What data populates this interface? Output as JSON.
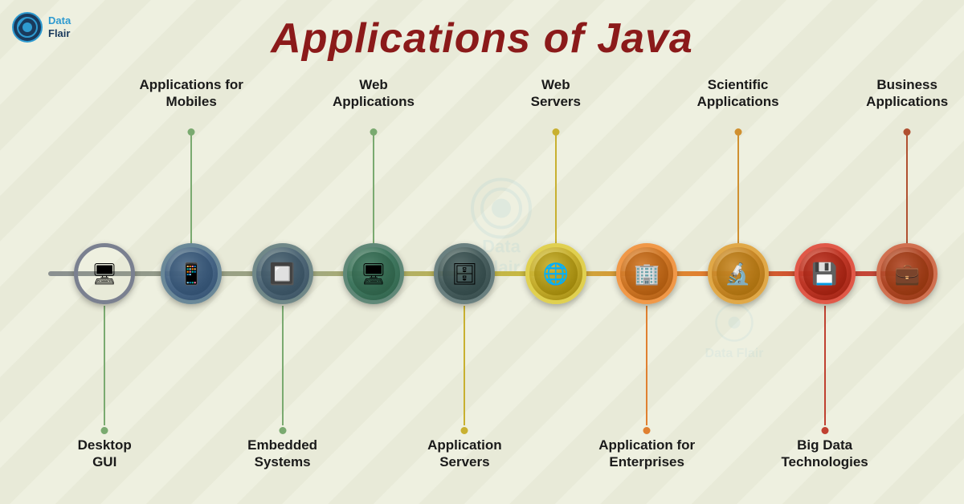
{
  "title": "Applications of Java",
  "logo": {
    "text_line1": "Data",
    "text_line2": "Flair"
  },
  "nodes": [
    {
      "id": 1,
      "label": "Desktop\nGUI",
      "position": "below",
      "left_pct": 6.5,
      "icon": "🖥",
      "line_color": "#7aaa70",
      "dot_color": "#7aaa70"
    },
    {
      "id": 2,
      "label": "Applications for\nMobiles",
      "position": "above",
      "left_pct": 16.5,
      "icon": "📱",
      "line_color": "#7aaa70",
      "dot_color": "#7aaa70"
    },
    {
      "id": 3,
      "label": "Embedded\nSystems",
      "position": "below",
      "left_pct": 27.0,
      "icon": "🔲",
      "line_color": "#7aaa70",
      "dot_color": "#7aaa70"
    },
    {
      "id": 4,
      "label": "Web\nApplications",
      "position": "above",
      "left_pct": 37.5,
      "icon": "🖥",
      "line_color": "#7aaa70",
      "dot_color": "#7aaa70"
    },
    {
      "id": 5,
      "label": "Application\nServers",
      "position": "below",
      "left_pct": 48.0,
      "icon": "🗄",
      "line_color": "#c8b030",
      "dot_color": "#c8b030"
    },
    {
      "id": 6,
      "label": "Web\nServers",
      "position": "above",
      "left_pct": 58.5,
      "icon": "🌐",
      "line_color": "#c8b030",
      "dot_color": "#c8b030"
    },
    {
      "id": 7,
      "label": "Application for\nEnterprises",
      "position": "below",
      "left_pct": 69.0,
      "icon": "🏢",
      "line_color": "#e08030",
      "dot_color": "#e08030"
    },
    {
      "id": 8,
      "label": "Scientific\nApplications",
      "position": "above",
      "left_pct": 79.5,
      "icon": "🔬",
      "line_color": "#d09030",
      "dot_color": "#d09030"
    },
    {
      "id": 9,
      "label": "Big Data\nTechnologies",
      "position": "below",
      "left_pct": 89.5,
      "icon": "💾",
      "line_color": "#c04030",
      "dot_color": "#c04030"
    },
    {
      "id": 10,
      "label": "Business\nApplications",
      "position": "above",
      "left_pct": 99.0,
      "icon": "💼",
      "line_color": "#b05030",
      "dot_color": "#b05030"
    }
  ],
  "watermark": {
    "line1": "Data",
    "line2": "Flair"
  }
}
